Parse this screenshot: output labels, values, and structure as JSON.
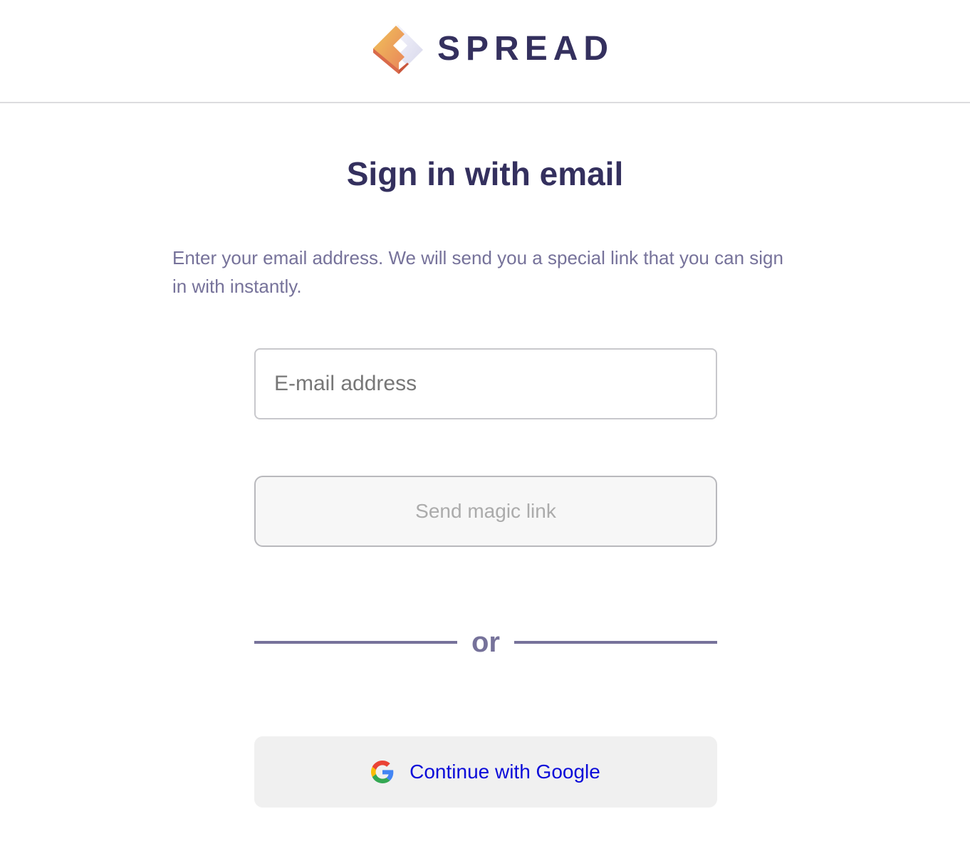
{
  "header": {
    "brand_name": "SPREAD",
    "logo_icon": "spread-logo-icon"
  },
  "main": {
    "title": "Sign in with email",
    "description": "Enter your email address. We will send you a special link that you can sign in with instantly.",
    "email_input": {
      "placeholder": "E-mail address",
      "value": ""
    },
    "send_button_label": "Send magic link",
    "divider_text": "or",
    "google_button": {
      "label": "Continue with Google",
      "icon": "google-icon"
    }
  },
  "colors": {
    "brand_text": "#34305e",
    "muted_text": "#76729a",
    "link_blue": "#0b0bd9",
    "disabled_text": "#ababab"
  }
}
